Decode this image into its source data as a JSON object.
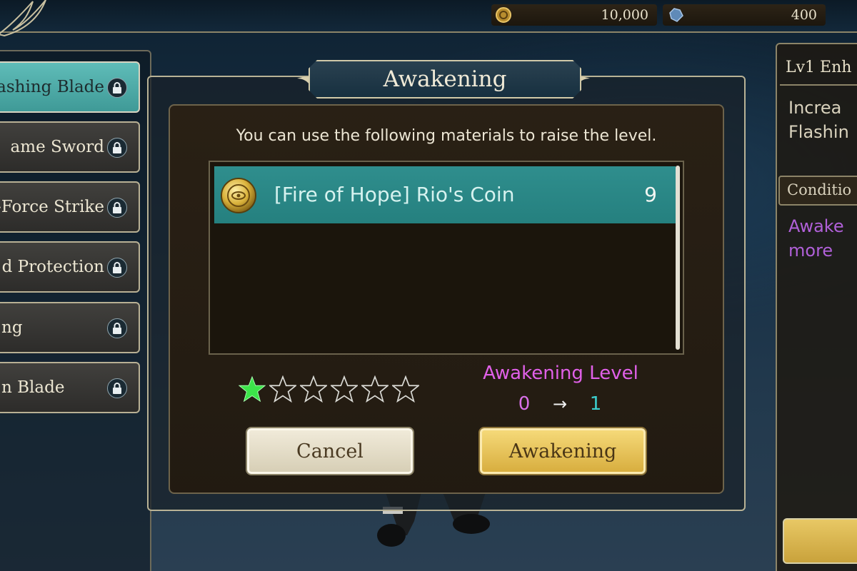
{
  "currency": {
    "gold": "10,000",
    "gems": "400"
  },
  "skills": [
    {
      "label": "Flashing Blade",
      "locked": true,
      "selected": true
    },
    {
      "label": "Flame Sword",
      "locked": true,
      "selected": false
    },
    {
      "label": "Soul-Force Strike",
      "locked": true,
      "selected": false
    },
    {
      "label": "Sword Protection",
      "locked": true,
      "selected": false
    },
    {
      "label": "Awakening",
      "locked": true,
      "selected": false
    },
    {
      "label": "Moon Blade",
      "locked": true,
      "selected": false
    }
  ],
  "skill_visible_labels": [
    "ashing Blade",
    "ame Sword",
    "-Force Strike",
    "d Protection",
    "ng",
    "n Blade"
  ],
  "info_panel": {
    "title": "Lv1 Enh",
    "description": "Increa\nFlashin",
    "condition_header": "Conditio",
    "condition_text": "Awake\nmore"
  },
  "dialog": {
    "title": "Awakening",
    "instruction": "You can use the following materials to raise the level.",
    "materials": [
      {
        "name": "[Fire of Hope] Rio's Coin",
        "count": "9",
        "icon": "coin-icon"
      }
    ],
    "stars": {
      "filled": 1,
      "total": 6
    },
    "level_label": "Awakening Level",
    "level_from": "0",
    "level_arrow": "→",
    "level_to": "1",
    "cancel_label": "Cancel",
    "confirm_label": "Awakening"
  },
  "colors": {
    "accent_teal": "#2f8e8d",
    "level_magenta": "#e060e8",
    "level_cyan": "#3cd0cf",
    "star_green": "#3ce44a",
    "button_gold": "#d8ae3f"
  }
}
